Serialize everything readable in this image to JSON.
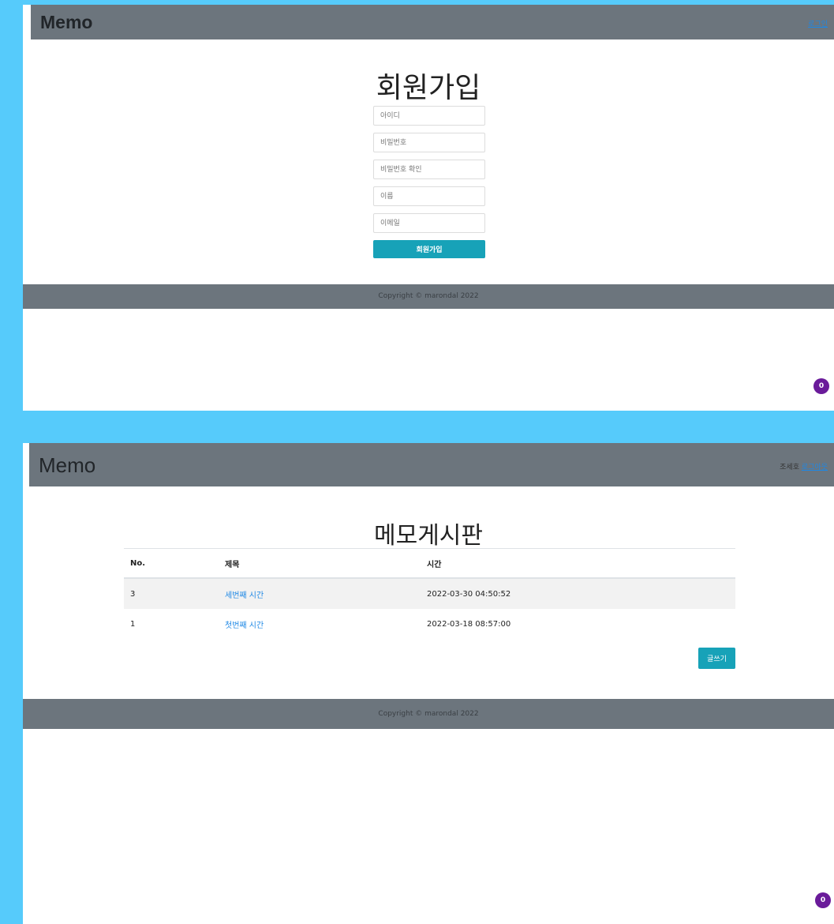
{
  "signup_page": {
    "brand": "Memo",
    "nav_link": "로그인",
    "title": "회원가입",
    "fields": {
      "id_placeholder": "아이디",
      "password_placeholder": "비밀번호",
      "password_confirm_placeholder": "비밀번호 확인",
      "name_placeholder": "이름",
      "email_placeholder": "이메일"
    },
    "submit_label": "회원가입",
    "footer": "Copyright © marondal 2022",
    "badge": "0"
  },
  "board_page": {
    "brand": "Memo",
    "user_greeting": "조세호",
    "logout_link": "로그아웃",
    "title": "메모게시판",
    "table": {
      "headers": [
        "No.",
        "제목",
        "시간"
      ],
      "rows": [
        {
          "no": "3",
          "title": "세번째 시간",
          "time": "2022-03-30 04:50:52"
        },
        {
          "no": "1",
          "title": "첫번째 시간",
          "time": "2022-03-18 08:57:00"
        }
      ]
    },
    "write_button": "글쓰기",
    "footer": "Copyright © marondal 2022",
    "badge": "0"
  },
  "colors": {
    "background": "#56cbfb",
    "navbar": "#6c757d",
    "accent": "#17a2b8",
    "link": "#1e88e5",
    "badge": "#6a1b9a"
  }
}
